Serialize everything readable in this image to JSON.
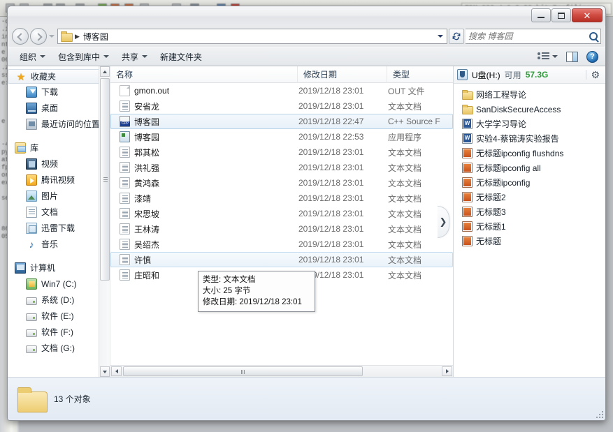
{
  "background": {
    "title_text": "TDM-GCC 4.9.2-32-bit Profiling",
    "code_lines": [
      "-c",
      ".i",
      "in",
      "nt",
      "e",
      "06",
      ".z",
      "ss",
      "e:",
      "",
      "",
      "",
      "",
      "e",
      "",
      "",
      "-4",
      "py",
      "at",
      "fp",
      "or",
      "ex",
      "",
      "se",
      "",
      "",
      "",
      "",
      "86",
      "05"
    ]
  },
  "window": {
    "controls": {
      "minimize": "minimize",
      "maximize": "maximize",
      "close": "✕"
    },
    "address": {
      "folder_icon": "folder-icon",
      "separator": "▶",
      "path": "博客园",
      "dropdown": "chevron-down-icon",
      "refresh": "↻"
    },
    "search": {
      "placeholder": "搜索 博客园",
      "icon": "search-icon"
    },
    "nav_back": "back-arrow-icon",
    "nav_forward": "forward-arrow-icon",
    "nav_history": "history-dropdown-icon"
  },
  "toolbar": {
    "items": [
      {
        "label": "组织",
        "has_caret": true
      },
      {
        "label": "包含到库中",
        "has_caret": true
      },
      {
        "label": "共享",
        "has_caret": true
      },
      {
        "label": "新建文件夹",
        "has_caret": false
      }
    ],
    "views_icon": "views-icon",
    "views_caret": "chevron-down-icon",
    "preview_pane_icon": "preview-pane-icon",
    "help_icon": "?"
  },
  "sidebar": {
    "groups": [
      {
        "header": {
          "label": "收藏夹",
          "icon": "star-icon",
          "selected": true
        },
        "items": [
          {
            "label": "下载",
            "icon": "download-icon"
          },
          {
            "label": "桌面",
            "icon": "desktop-icon"
          },
          {
            "label": "最近访问的位置",
            "icon": "recent-places-icon"
          }
        ]
      },
      {
        "header": {
          "label": "库",
          "icon": "library-icon",
          "selected": false
        },
        "items": [
          {
            "label": "视频",
            "icon": "video-icon"
          },
          {
            "label": "腾讯视频",
            "icon": "tencent-video-icon"
          },
          {
            "label": "图片",
            "icon": "pictures-icon"
          },
          {
            "label": "文档",
            "icon": "documents-icon"
          },
          {
            "label": "迅雷下载",
            "icon": "thunder-download-icon"
          },
          {
            "label": "音乐",
            "icon": "music-icon"
          }
        ]
      },
      {
        "header": {
          "label": "计算机",
          "icon": "computer-icon",
          "selected": false
        },
        "items": [
          {
            "label": "Win7 (C:)",
            "icon": "windows-drive-icon"
          },
          {
            "label": "系统 (D:)",
            "icon": "drive-icon"
          },
          {
            "label": "软件 (E:)",
            "icon": "drive-icon"
          },
          {
            "label": "软件 (F:)",
            "icon": "drive-icon"
          },
          {
            "label": "文档 (G:)",
            "icon": "drive-icon"
          }
        ]
      }
    ]
  },
  "filelist": {
    "columns": [
      {
        "key": "name",
        "label": "名称"
      },
      {
        "key": "date",
        "label": "修改日期"
      },
      {
        "key": "type",
        "label": "类型"
      }
    ],
    "rows": [
      {
        "name": "gmon.out",
        "date": "2019/12/18 23:01",
        "type": "OUT 文件",
        "icon": "blank-file-icon",
        "state": ""
      },
      {
        "name": "安省龙",
        "date": "2019/12/18 23:01",
        "type": "文本文档",
        "icon": "text-file-icon",
        "state": ""
      },
      {
        "name": "博客园",
        "date": "2019/12/18 22:47",
        "type": "C++ Source F",
        "icon": "cpp-file-icon",
        "state": "sel"
      },
      {
        "name": "博客园",
        "date": "2019/12/18 22:53",
        "type": "应用程序",
        "icon": "exe-file-icon",
        "state": ""
      },
      {
        "name": "郭其松",
        "date": "2019/12/18 23:01",
        "type": "文本文档",
        "icon": "text-file-icon",
        "state": ""
      },
      {
        "name": "洪礼强",
        "date": "2019/12/18 23:01",
        "type": "文本文档",
        "icon": "text-file-icon",
        "state": ""
      },
      {
        "name": "黄鸿森",
        "date": "2019/12/18 23:01",
        "type": "文本文档",
        "icon": "text-file-icon",
        "state": ""
      },
      {
        "name": "漆靖",
        "date": "2019/12/18 23:01",
        "type": "文本文档",
        "icon": "text-file-icon",
        "state": ""
      },
      {
        "name": "宋思坡",
        "date": "2019/12/18 23:01",
        "type": "文本文档",
        "icon": "text-file-icon",
        "state": ""
      },
      {
        "name": "王林涛",
        "date": "2019/12/18 23:01",
        "type": "文本文档",
        "icon": "text-file-icon",
        "state": ""
      },
      {
        "name": "吴绍杰",
        "date": "2019/12/18 23:01",
        "type": "文本文档",
        "icon": "text-file-icon",
        "state": ""
      },
      {
        "name": "许慎",
        "date": "2019/12/18 23:01",
        "type": "文本文档",
        "icon": "text-file-icon",
        "state": "hov"
      },
      {
        "name": "庄昭和",
        "date": "2019/12/18 23:01",
        "type": "文本文档",
        "icon": "text-file-icon",
        "state": ""
      }
    ]
  },
  "tooltip": {
    "line1": "类型: 文本文档",
    "line2": "大小: 25 字节",
    "line3": "修改日期: 2019/12/18 23:01"
  },
  "expander": {
    "icon": "chevron-right-icon",
    "glyph": "❯"
  },
  "rightpane": {
    "header": {
      "drive_icon": "usb-drive-icon",
      "drive_label": "U盘(H:)",
      "free_label": "可用",
      "free_size": "57.3G",
      "gear_icon": "gear-icon",
      "size_color": "#2e9c3a"
    },
    "items": [
      {
        "label": "网络工程导论",
        "icon": "folder-icon"
      },
      {
        "label": "SanDiskSecureAccess",
        "icon": "folder-icon"
      },
      {
        "label": "大学学习导论",
        "icon": "word-doc-icon"
      },
      {
        "label": "实验4-蔡锦涛实验报告",
        "icon": "word-doc-icon"
      },
      {
        "label": "无标题ipconfig flushdns",
        "icon": "ppt-doc-icon"
      },
      {
        "label": "无标题ipconfig all",
        "icon": "ppt-doc-icon"
      },
      {
        "label": "无标题ipconfig",
        "icon": "ppt-doc-icon"
      },
      {
        "label": "无标题2",
        "icon": "ppt-doc-icon"
      },
      {
        "label": "无标题3",
        "icon": "ppt-doc-icon"
      },
      {
        "label": "无标题1",
        "icon": "ppt-doc-icon"
      },
      {
        "label": "无标题",
        "icon": "ppt-doc-icon"
      }
    ]
  },
  "statusbar": {
    "folder_icon": "folder-icon",
    "text": "13 个对象"
  }
}
